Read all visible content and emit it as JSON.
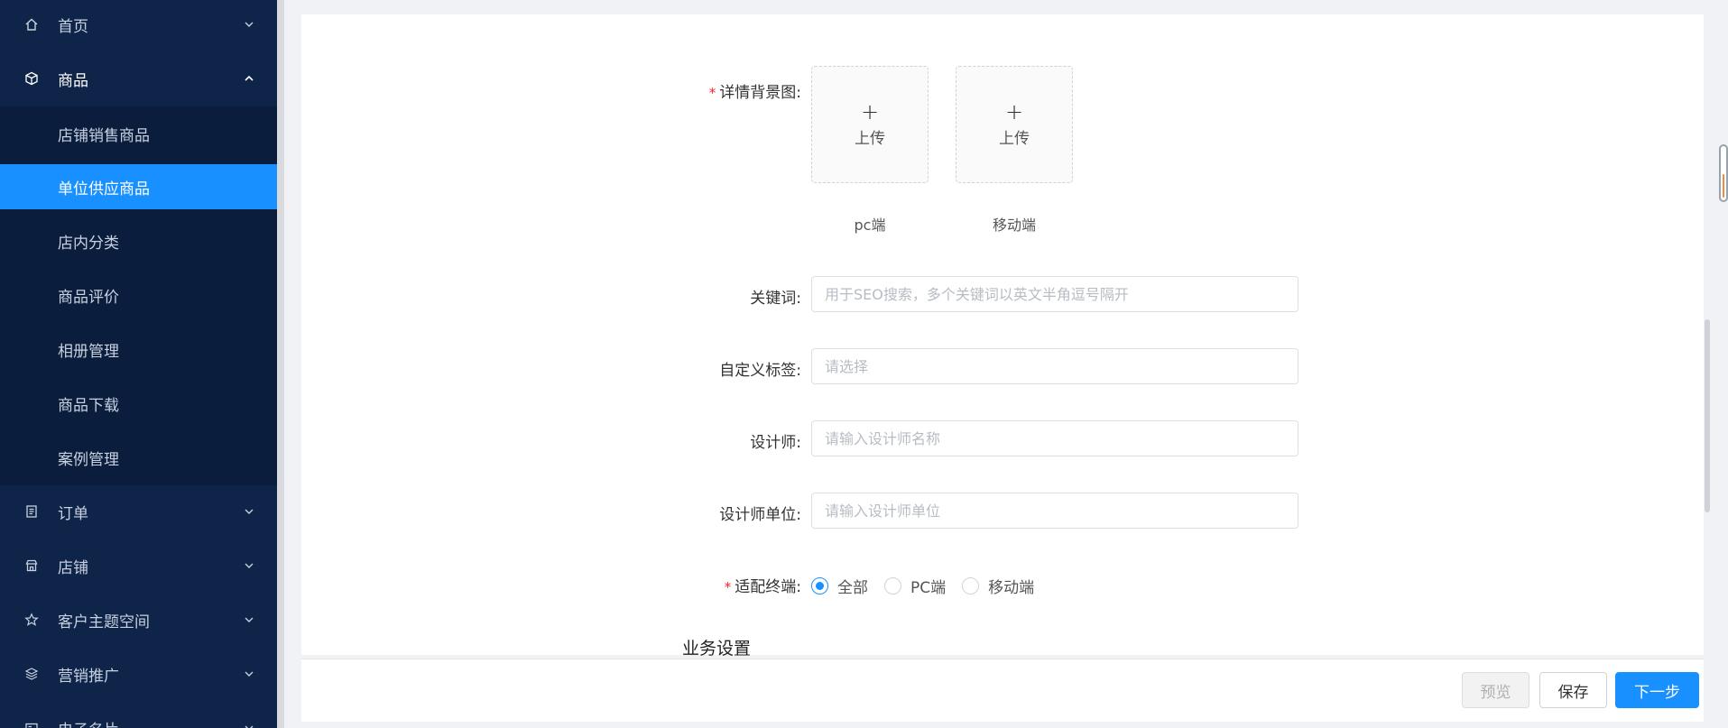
{
  "sidebar": {
    "menu_top": [
      {
        "label": "首页",
        "icon": "home-icon"
      },
      {
        "label": "商品",
        "icon": "cube-icon"
      }
    ],
    "goods_submenu": [
      {
        "label": "店铺销售商品"
      },
      {
        "label": "单位供应商品"
      },
      {
        "label": "店内分类"
      },
      {
        "label": "商品评价"
      },
      {
        "label": "相册管理"
      },
      {
        "label": "商品下载"
      },
      {
        "label": "案例管理"
      }
    ],
    "menu_bottom": [
      {
        "label": "订单",
        "icon": "order-icon"
      },
      {
        "label": "店铺",
        "icon": "shop-icon"
      },
      {
        "label": "客户主题空间",
        "icon": "star-icon"
      },
      {
        "label": "营销推广",
        "icon": "layers-icon"
      },
      {
        "label": "电子名片",
        "icon": "card-icon"
      }
    ]
  },
  "form": {
    "detail_bg": {
      "label": "详情背景图:",
      "upload_text": "上传",
      "upload_plus": "+",
      "caption_pc": "pc端",
      "caption_mobile": "移动端"
    },
    "keywords": {
      "label": "关键词:",
      "placeholder": "用于SEO搜索，多个关键词以英文半角逗号隔开"
    },
    "custom_tags": {
      "label": "自定义标签:",
      "placeholder": "请选择"
    },
    "designer": {
      "label": "设计师:",
      "placeholder": "请输入设计师名称"
    },
    "designer_unit": {
      "label": "设计师单位:",
      "placeholder": "请输入设计师单位"
    },
    "terminal": {
      "label": "适配终端:",
      "options": [
        "全部",
        "PC端",
        "移动端"
      ],
      "selected": "全部"
    },
    "required_mark": "*",
    "section_business": "业务设置"
  },
  "footer": {
    "preview_label": "预览",
    "save_label": "保存",
    "next_label": "下一步"
  },
  "colors": {
    "sidebar_bg": "#0e2449",
    "submenu_bg": "#0a1d3d",
    "active_blue": "#1890ff",
    "required_red": "#f5222d"
  }
}
